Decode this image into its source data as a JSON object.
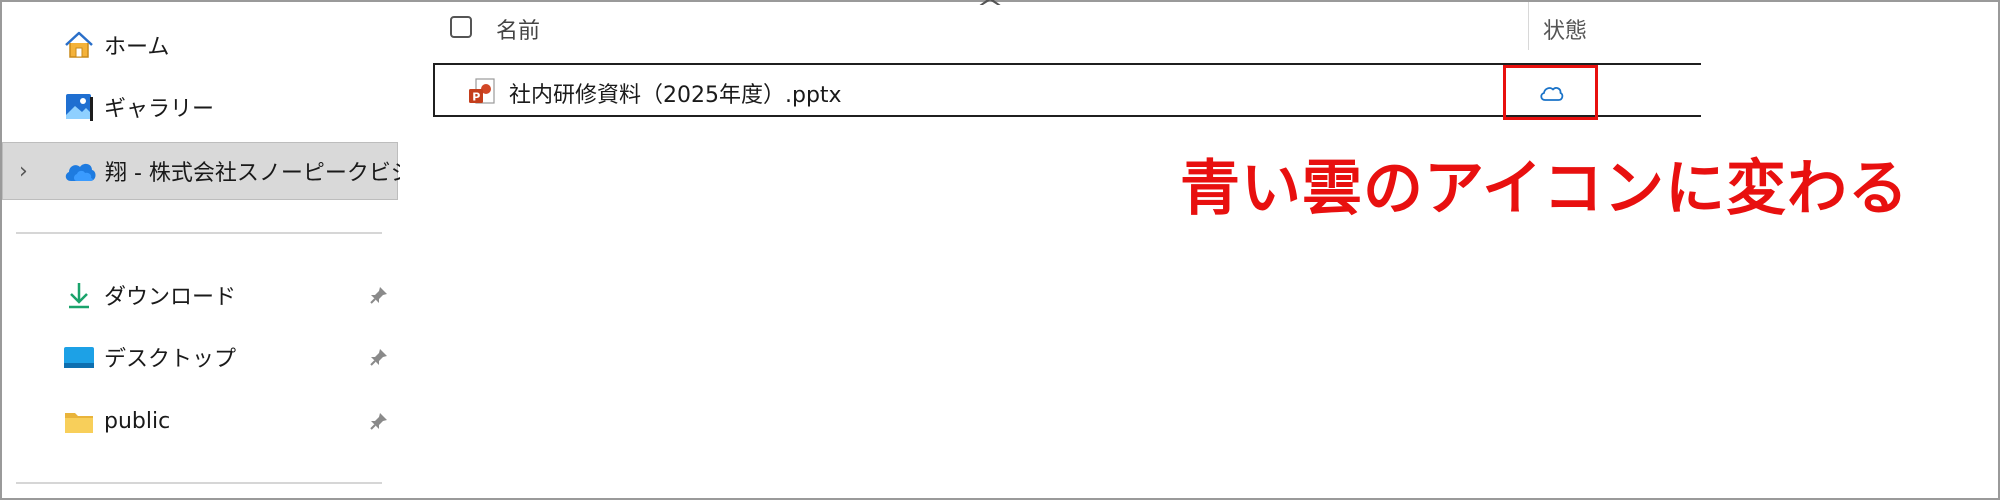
{
  "sidebar": {
    "items": [
      {
        "label": "ホーム",
        "icon": "home-icon"
      },
      {
        "label": "ギャラリー",
        "icon": "gallery-icon"
      },
      {
        "label": "翔 - 株式会社スノーピークビジネ",
        "icon": "onedrive-cloud-icon",
        "selected": true,
        "expand_icon": "chevron-right-icon"
      }
    ],
    "quick_access": [
      {
        "label": "ダウンロード",
        "icon": "download-icon",
        "pin_icon": "pin-icon"
      },
      {
        "label": "デスクトップ",
        "icon": "desktop-icon",
        "pin_icon": "pin-icon"
      },
      {
        "label": "public",
        "icon": "folder-icon",
        "pin_icon": "pin-icon"
      }
    ]
  },
  "file_list": {
    "columns": {
      "name": "名前",
      "status": "状態"
    },
    "sort_icon": "sort-ascending-icon",
    "rows": [
      {
        "name": "社内研修資料（2025年度）.pptx",
        "icon": "powerpoint-file-icon",
        "status_icon": "cloud-online-only-icon"
      }
    ]
  },
  "annotation": {
    "text": "青い雲のアイコンに変わる",
    "color": "#e8100f"
  },
  "colors": {
    "accent_red": "#e8100f",
    "cloud_blue": "#1a73c8",
    "selected_bg": "#d9d9d9"
  }
}
